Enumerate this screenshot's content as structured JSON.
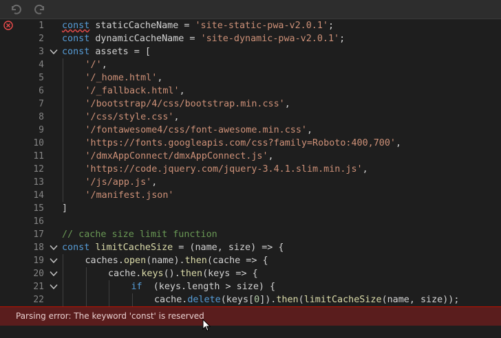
{
  "toolbar": {
    "undo_icon": "undo-icon",
    "redo_icon": "redo-icon"
  },
  "colors": {
    "keyword": "#569cd6",
    "string": "#ce9178",
    "comment": "#6a9955",
    "function": "#dcdcaa",
    "number": "#b5cea8",
    "error_bar": "#5a1d1d"
  },
  "editor": {
    "error_line": 1,
    "lines": [
      {
        "n": "1",
        "fold": false,
        "indent": 0,
        "tokens": [
          [
            "kw squig",
            "const"
          ],
          [
            "",
            "staticCacheName = "
          ],
          [
            "str",
            "'site-static-pwa-v2.0.1'"
          ],
          [
            "",
            ";"
          ]
        ]
      },
      {
        "n": "2",
        "fold": false,
        "indent": 0,
        "tokens": [
          [
            "kw",
            "const"
          ],
          [
            "",
            "dynamicCacheName = "
          ],
          [
            "str",
            "'site-dynamic-pwa-v2.0.1'"
          ],
          [
            "",
            ";"
          ]
        ]
      },
      {
        "n": "3",
        "fold": true,
        "indent": 0,
        "tokens": [
          [
            "kw",
            "const"
          ],
          [
            "",
            "assets = ["
          ]
        ]
      },
      {
        "n": "4",
        "fold": false,
        "indent": 1,
        "tokens": [
          [
            "str",
            "'/'"
          ],
          [
            "",
            ","
          ]
        ]
      },
      {
        "n": "5",
        "fold": false,
        "indent": 1,
        "tokens": [
          [
            "str",
            "'/_home.html'"
          ],
          [
            "",
            ","
          ]
        ]
      },
      {
        "n": "6",
        "fold": false,
        "indent": 1,
        "tokens": [
          [
            "str",
            "'/_fallback.html'"
          ],
          [
            "",
            ","
          ]
        ]
      },
      {
        "n": "7",
        "fold": false,
        "indent": 1,
        "tokens": [
          [
            "str",
            "'/bootstrap/4/css/bootstrap.min.css'"
          ],
          [
            "",
            ","
          ]
        ]
      },
      {
        "n": "8",
        "fold": false,
        "indent": 1,
        "tokens": [
          [
            "str",
            "'/css/style.css'"
          ],
          [
            "",
            ","
          ]
        ]
      },
      {
        "n": "9",
        "fold": false,
        "indent": 1,
        "tokens": [
          [
            "str",
            "'/fontawesome4/css/font-awesome.min.css'"
          ],
          [
            "",
            ","
          ]
        ]
      },
      {
        "n": "10",
        "fold": false,
        "indent": 1,
        "tokens": [
          [
            "str",
            "'https://fonts.googleapis.com/css?family=Roboto:400,700'"
          ],
          [
            "",
            ","
          ]
        ]
      },
      {
        "n": "11",
        "fold": false,
        "indent": 1,
        "tokens": [
          [
            "str",
            "'/dmxAppConnect/dmxAppConnect.js'"
          ],
          [
            "",
            ","
          ]
        ]
      },
      {
        "n": "12",
        "fold": false,
        "indent": 1,
        "tokens": [
          [
            "str",
            "'https://code.jquery.com/jquery-3.4.1.slim.min.js'"
          ],
          [
            "",
            ","
          ]
        ]
      },
      {
        "n": "13",
        "fold": false,
        "indent": 1,
        "tokens": [
          [
            "str",
            "'/js/app.js'"
          ],
          [
            "",
            ","
          ]
        ]
      },
      {
        "n": "14",
        "fold": false,
        "indent": 1,
        "tokens": [
          [
            "str",
            "'/manifest.json'"
          ]
        ]
      },
      {
        "n": "15",
        "fold": false,
        "indent": 0,
        "tokens": [
          [
            "",
            "]"
          ]
        ]
      },
      {
        "n": "16",
        "fold": false,
        "indent": 0,
        "tokens": []
      },
      {
        "n": "17",
        "fold": false,
        "indent": 0,
        "tokens": [
          [
            "cm",
            "// cache size limit function"
          ]
        ]
      },
      {
        "n": "18",
        "fold": true,
        "indent": 0,
        "tokens": [
          [
            "kw",
            "const"
          ],
          [
            "fn",
            "limitCacheSize"
          ],
          [
            "",
            " = (name, size) => {"
          ]
        ]
      },
      {
        "n": "19",
        "fold": true,
        "indent": 1,
        "tokens": [
          [
            "",
            "caches."
          ],
          [
            "fn",
            "open"
          ],
          [
            "",
            "(name)."
          ],
          [
            "fn",
            "then"
          ],
          [
            "",
            "(cache => {"
          ]
        ]
      },
      {
        "n": "20",
        "fold": true,
        "indent": 2,
        "tokens": [
          [
            "",
            "cache."
          ],
          [
            "fn",
            "keys"
          ],
          [
            "",
            "()."
          ],
          [
            "fn",
            "then"
          ],
          [
            "",
            "(keys => {"
          ]
        ]
      },
      {
        "n": "21",
        "fold": true,
        "indent": 3,
        "tokens": [
          [
            "kw",
            "if"
          ],
          [
            "",
            " (keys.length > size) {"
          ]
        ]
      },
      {
        "n": "22",
        "fold": false,
        "indent": 4,
        "tokens": [
          [
            "",
            "cache."
          ],
          [
            "kw",
            "delete"
          ],
          [
            "",
            "(keys["
          ],
          [
            "num",
            "0"
          ],
          [
            "",
            "])."
          ],
          [
            "fn",
            "then"
          ],
          [
            "",
            "("
          ],
          [
            "fn",
            "limitCacheSize"
          ],
          [
            "",
            "(name, size));"
          ]
        ]
      }
    ]
  },
  "error_bar": {
    "message": "Parsing error: The keyword 'const' is reserved"
  }
}
